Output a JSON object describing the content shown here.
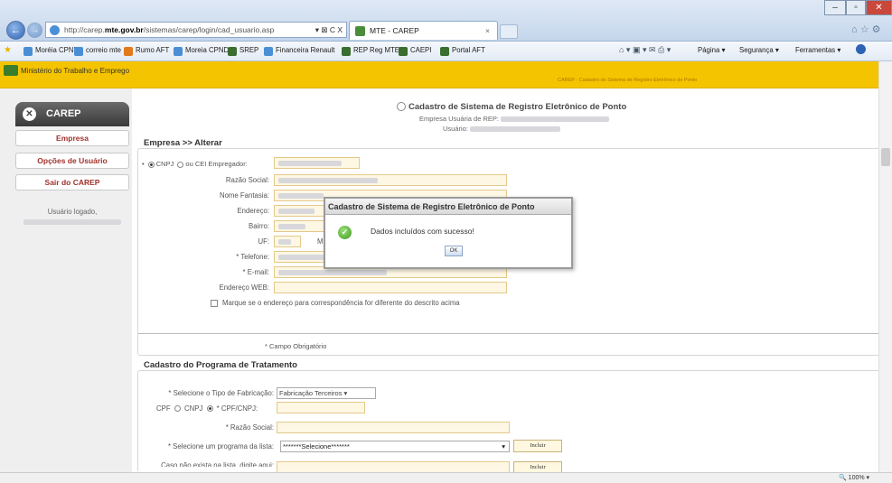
{
  "browser": {
    "address_host_prefix": "http://carep.",
    "address_host_bold": "mte.gov.br",
    "address_path": "/sistemas/carep/login/cad_usuario.asp",
    "address_tools": "▾ ⊠ C X",
    "tab_title": "MTE - CAREP",
    "tab_close": "×",
    "favorites": [
      {
        "label": "Moréia CPND",
        "color": "#4a8fd6"
      },
      {
        "label": "correio mte",
        "color": "#4a8fd6"
      },
      {
        "label": "Rumo AFT",
        "color": "#e07a1a"
      },
      {
        "label": "Moreia CPND",
        "color": "#4a8fd6"
      },
      {
        "label": "SREP",
        "color": "#3a6e2e"
      },
      {
        "label": "Financeira Renault",
        "color": "#4a8fd6"
      },
      {
        "label": "REP Reg MTE",
        "color": "#3a6e2e"
      },
      {
        "label": "CAEPI",
        "color": "#3a6e2e"
      },
      {
        "label": "Portal AFT",
        "color": "#3a6e2e"
      }
    ],
    "commands": {
      "pagina": "Página ▾",
      "seguranca": "Segurança ▾",
      "ferramentas": "Ferramentas ▾"
    },
    "zoom": "100%"
  },
  "header": {
    "ministry": "Ministério do Trabalho e Emprego",
    "caption": "CAREP - Cadastro do Sistema de Registro Eletrônico de Ponto"
  },
  "sidebar": {
    "title": "CAREP",
    "items": [
      "Empresa",
      "Opções de Usuário",
      "Sair do CAREP"
    ],
    "user_label": "Usuário logado,"
  },
  "main": {
    "title": "Cadastro de Sistema de Registro Eletrônico de Ponto",
    "empresa_label": "Empresa Usuária de REP:",
    "usuario_label": "Usuário:",
    "section1": "Empresa >> Alterar",
    "cnpj_option": "CNPJ",
    "cei_option": "ou CEI Empregador:",
    "fields": [
      "Razão Social:",
      "Nome Fantasia:",
      "Endereço:",
      "Bairro:",
      "UF:",
      "* Telefone:",
      "* E-mail:",
      "Endereço WEB:"
    ],
    "uf_extra": "M",
    "checkbox_label": "Marque se o endereço para correspondência for diferente do descrito acima",
    "required_note": "* Campo Obrigatório",
    "section2": "Cadastro do Programa de Tratamento",
    "tipo_label": "* Selecione o Tipo de Fabricação:",
    "tipo_value": "Fabricação Terceiros ▾",
    "cpf_label": "CPF",
    "cnpj_label": "CNPJ",
    "cpfcnpj_label": "* CPF/CNPJ:",
    "razao_label": "* Razão Social:",
    "programa_label": "* Selecione um programa da lista:",
    "programa_value": "*******Selecione*******",
    "incluir": "Incluir",
    "caso_label": "Caso não exista na lista, digite aqui:"
  },
  "dialog": {
    "title": "Cadastro de Sistema de Registro Eletrônico de Ponto",
    "message": "Dados incluídos com sucesso!",
    "ok": "OK"
  }
}
